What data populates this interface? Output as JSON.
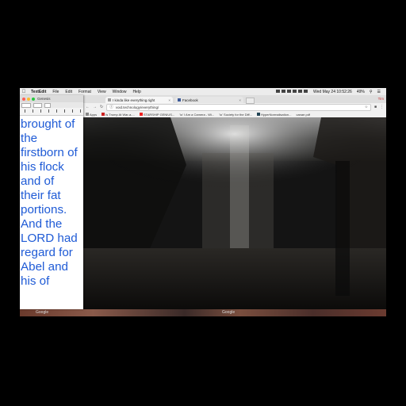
{
  "menubar": {
    "app_name": "TextEdit",
    "items": [
      "File",
      "Edit",
      "Format",
      "View",
      "Window",
      "Help"
    ],
    "date_time": "Wed May 24  10:52:26",
    "battery": "49%"
  },
  "textedit": {
    "title": "Genesis",
    "text_lines": [
      "brought of",
      "the",
      "firstborn of",
      "his flock",
      "and of",
      "their fat",
      "portions.",
      "And the",
      "LORD had",
      "regard for",
      "Abel and",
      "his of"
    ]
  },
  "chrome": {
    "tabs": [
      {
        "label": "I kinda like everything.right",
        "active": true
      },
      {
        "label": "Facebook",
        "active": false
      }
    ],
    "user": "Tim",
    "url": "void.technology/everything/",
    "apps_label": "Apps",
    "bookmarks": [
      "Is Trump At War-a-...",
      "STARSHIP GENIUS...",
      "'io' I Am a Camera - Wi...",
      "'io' Society for the Diff...",
      "HyperNormalisation...",
      "canae.pdf"
    ]
  },
  "taskbar": {
    "labels": [
      "Google",
      "Google"
    ]
  },
  "colors": {
    "text_blue": "#1f5bd6",
    "menubar": "#ececec"
  }
}
